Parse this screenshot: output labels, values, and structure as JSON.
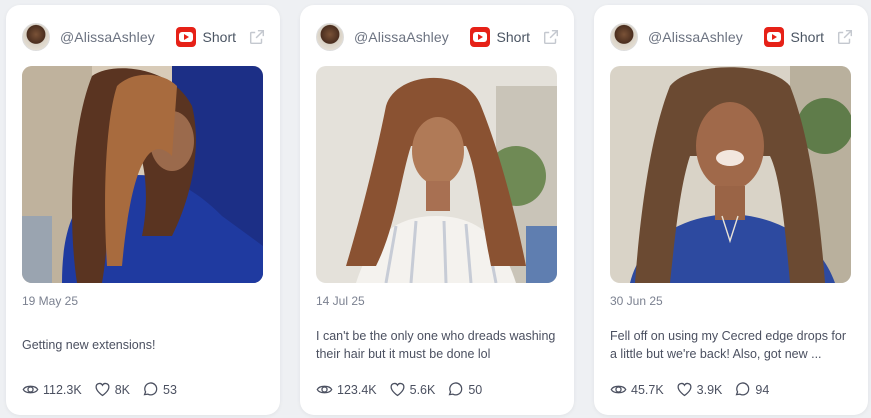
{
  "cards": [
    {
      "handle": "@AlissaAshley",
      "platform_icon": "youtube-shorts-icon",
      "type_label": "Short",
      "date": "19 May 25",
      "caption": "Getting new extensions!",
      "views": "112.3K",
      "likes": "8K",
      "comments": "53"
    },
    {
      "handle": "@AlissaAshley",
      "platform_icon": "youtube-shorts-icon",
      "type_label": "Short",
      "date": "14 Jul 25",
      "caption": "I can't be the only one who dreads washing their hair but it must be done lol",
      "views": "123.4K",
      "likes": "5.6K",
      "comments": "50"
    },
    {
      "handle": "@AlissaAshley",
      "platform_icon": "youtube-shorts-icon",
      "type_label": "Short",
      "date": "30 Jun 25",
      "caption": "Fell off on using my Cecred edge drops for a little but we're back! Also, got new ...",
      "views": "45.7K",
      "likes": "3.9K",
      "comments": "94"
    }
  ],
  "colors": {
    "youtube_red": "#e62117",
    "card_bg": "#ffffff",
    "page_bg": "#eef0f3"
  }
}
